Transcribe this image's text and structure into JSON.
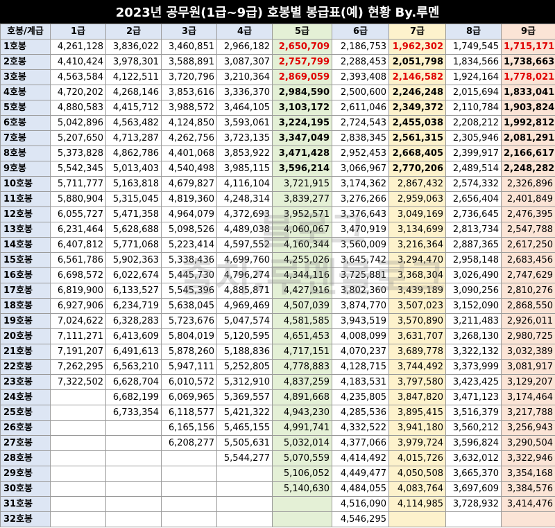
{
  "title": "2023년 공무원(1급~9급) 호봉별 봉급표(예) 현황 By.루멘",
  "header": [
    "호봉/계급",
    "1급",
    "2급",
    "3급",
    "4급",
    "5급",
    "6급",
    "7급",
    "8급",
    "9급"
  ],
  "rows": [
    {
      "step": "1호봉",
      "v": [
        "4,261,128",
        "3,836,022",
        "3,460,851",
        "2,966,182",
        "2,650,709",
        "2,186,753",
        "1,962,302",
        "1,749,545",
        "1,715,171"
      ]
    },
    {
      "step": "2호봉",
      "v": [
        "4,410,424",
        "3,978,301",
        "3,588,891",
        "3,087,307",
        "2,757,799",
        "2,288,453",
        "2,051,798",
        "1,834,566",
        "1,738,663"
      ]
    },
    {
      "step": "3호봉",
      "v": [
        "4,563,584",
        "4,122,511",
        "3,720,796",
        "3,210,364",
        "2,869,059",
        "2,393,408",
        "2,146,582",
        "1,924,164",
        "1,778,021"
      ]
    },
    {
      "step": "4호봉",
      "v": [
        "4,720,202",
        "4,268,146",
        "3,853,616",
        "3,336,370",
        "2,984,590",
        "2,500,600",
        "2,246,248",
        "2,015,694",
        "1,833,041"
      ]
    },
    {
      "step": "5호봉",
      "v": [
        "4,880,583",
        "4,415,712",
        "3,988,572",
        "3,464,105",
        "3,103,172",
        "2,611,046",
        "2,349,372",
        "2,110,784",
        "1,903,824"
      ]
    },
    {
      "step": "6호봉",
      "v": [
        "5,042,896",
        "4,563,482",
        "4,124,850",
        "3,593,061",
        "3,224,195",
        "2,724,543",
        "2,455,038",
        "2,208,212",
        "1,992,812"
      ]
    },
    {
      "step": "7호봉",
      "v": [
        "5,207,650",
        "4,713,287",
        "4,262,756",
        "3,723,135",
        "3,347,049",
        "2,838,345",
        "2,561,315",
        "2,305,946",
        "2,081,291"
      ]
    },
    {
      "step": "8호봉",
      "v": [
        "5,373,828",
        "4,862,786",
        "4,401,068",
        "3,853,922",
        "3,471,428",
        "2,952,453",
        "2,668,405",
        "2,399,917",
        "2,166,617"
      ]
    },
    {
      "step": "9호봉",
      "v": [
        "5,542,345",
        "5,013,403",
        "4,540,498",
        "3,985,115",
        "3,596,214",
        "3,066,967",
        "2,770,206",
        "2,489,514",
        "2,248,282"
      ]
    },
    {
      "step": "10호봉",
      "v": [
        "5,711,777",
        "5,163,818",
        "4,679,827",
        "4,116,104",
        "3,721,915",
        "3,174,362",
        "2,867,432",
        "2,574,332",
        "2,326,896"
      ]
    },
    {
      "step": "11호봉",
      "v": [
        "5,880,904",
        "5,315,045",
        "4,819,360",
        "4,248,314",
        "3,839,277",
        "3,276,266",
        "2,959,063",
        "2,656,404",
        "2,401,849"
      ]
    },
    {
      "step": "12호봉",
      "v": [
        "6,055,727",
        "5,471,358",
        "4,964,079",
        "4,372,693",
        "3,952,571",
        "3,376,643",
        "3,049,169",
        "2,736,645",
        "2,476,395"
      ]
    },
    {
      "step": "13호봉",
      "v": [
        "6,231,464",
        "5,628,688",
        "5,098,526",
        "4,489,038",
        "4,060,067",
        "3,470,919",
        "3,134,699",
        "2,813,734",
        "2,547,788"
      ]
    },
    {
      "step": "14호봉",
      "v": [
        "6,407,812",
        "5,771,068",
        "5,223,414",
        "4,597,552",
        "4,160,344",
        "3,560,009",
        "3,216,364",
        "2,887,365",
        "2,617,250"
      ]
    },
    {
      "step": "15호봉",
      "v": [
        "6,561,786",
        "5,902,363",
        "5,338,436",
        "4,699,760",
        "4,255,026",
        "3,645,742",
        "3,294,470",
        "2,958,148",
        "2,683,456"
      ]
    },
    {
      "step": "16호봉",
      "v": [
        "6,698,572",
        "6,022,674",
        "5,445,730",
        "4,796,274",
        "4,344,116",
        "3,725,881",
        "3,368,304",
        "3,026,490",
        "2,747,629"
      ]
    },
    {
      "step": "17호봉",
      "v": [
        "6,819,900",
        "6,133,527",
        "5,545,396",
        "4,885,871",
        "4,427,916",
        "3,802,360",
        "3,439,189",
        "3,090,256",
        "2,810,276"
      ]
    },
    {
      "step": "18호봉",
      "v": [
        "6,927,906",
        "6,234,719",
        "5,638,045",
        "4,969,469",
        "4,507,039",
        "3,874,770",
        "3,507,023",
        "3,152,090",
        "2,868,550"
      ]
    },
    {
      "step": "19호봉",
      "v": [
        "7,024,622",
        "6,328,283",
        "5,723,676",
        "5,047,574",
        "4,581,585",
        "3,943,519",
        "3,570,890",
        "3,211,483",
        "2,926,011"
      ]
    },
    {
      "step": "20호봉",
      "v": [
        "7,111,271",
        "6,413,609",
        "5,804,019",
        "5,120,595",
        "4,651,453",
        "4,008,099",
        "3,631,707",
        "3,268,130",
        "2,980,725"
      ]
    },
    {
      "step": "21호봉",
      "v": [
        "7,191,207",
        "6,491,613",
        "5,878,260",
        "5,188,836",
        "4,717,151",
        "4,070,237",
        "3,689,778",
        "3,322,132",
        "3,032,389"
      ]
    },
    {
      "step": "22호봉",
      "v": [
        "7,262,295",
        "6,563,210",
        "5,947,111",
        "5,252,805",
        "4,778,883",
        "4,128,715",
        "3,744,492",
        "3,373,999",
        "3,081,917"
      ]
    },
    {
      "step": "23호봉",
      "v": [
        "7,322,502",
        "6,628,704",
        "6,010,572",
        "5,312,910",
        "4,837,259",
        "4,183,531",
        "3,797,580",
        "3,423,425",
        "3,129,207"
      ]
    },
    {
      "step": "24호봉",
      "v": [
        "",
        "6,682,199",
        "6,069,965",
        "5,369,557",
        "4,891,668",
        "4,235,805",
        "3,847,820",
        "3,471,123",
        "3,174,464"
      ]
    },
    {
      "step": "25호봉",
      "v": [
        "",
        "6,733,354",
        "6,118,577",
        "5,421,322",
        "4,943,230",
        "4,285,536",
        "3,895,415",
        "3,516,379",
        "3,217,788"
      ]
    },
    {
      "step": "26호봉",
      "v": [
        "",
        "",
        "6,165,156",
        "5,465,155",
        "4,991,741",
        "4,332,522",
        "3,941,180",
        "3,560,212",
        "3,256,943"
      ]
    },
    {
      "step": "27호봉",
      "v": [
        "",
        "",
        "6,208,277",
        "5,505,631",
        "5,032,014",
        "4,377,066",
        "3,979,724",
        "3,596,824",
        "3,290,504"
      ]
    },
    {
      "step": "28호봉",
      "v": [
        "",
        "",
        "",
        "5,544,277",
        "5,070,559",
        "4,414,492",
        "4,015,726",
        "3,632,012",
        "3,322,946"
      ]
    },
    {
      "step": "29호봉",
      "v": [
        "",
        "",
        "",
        "",
        "5,106,052",
        "4,449,477",
        "4,050,508",
        "3,665,370",
        "3,354,168"
      ]
    },
    {
      "step": "30호봉",
      "v": [
        "",
        "",
        "",
        "",
        "5,140,630",
        "4,484,055",
        "4,083,764",
        "3,697,609",
        "3,384,576"
      ]
    },
    {
      "step": "31호봉",
      "v": [
        "",
        "",
        "",
        "",
        "",
        "4,516,090",
        "4,114,985",
        "3,728,932",
        "3,414,476"
      ]
    },
    {
      "step": "32호봉",
      "v": [
        "",
        "",
        "",
        "",
        "",
        "4,546,295",
        "",
        "",
        ""
      ]
    }
  ],
  "watermark": [
    "블로그",
    "출처:루멘블로그"
  ],
  "colors": {
    "header_bg": "#dde6f4",
    "grade5_bg": "#e4f0d6",
    "grade7_bg": "#fdf2cc",
    "grade9_bg": "#fbe4d6",
    "highlight_red": "#e00000"
  }
}
